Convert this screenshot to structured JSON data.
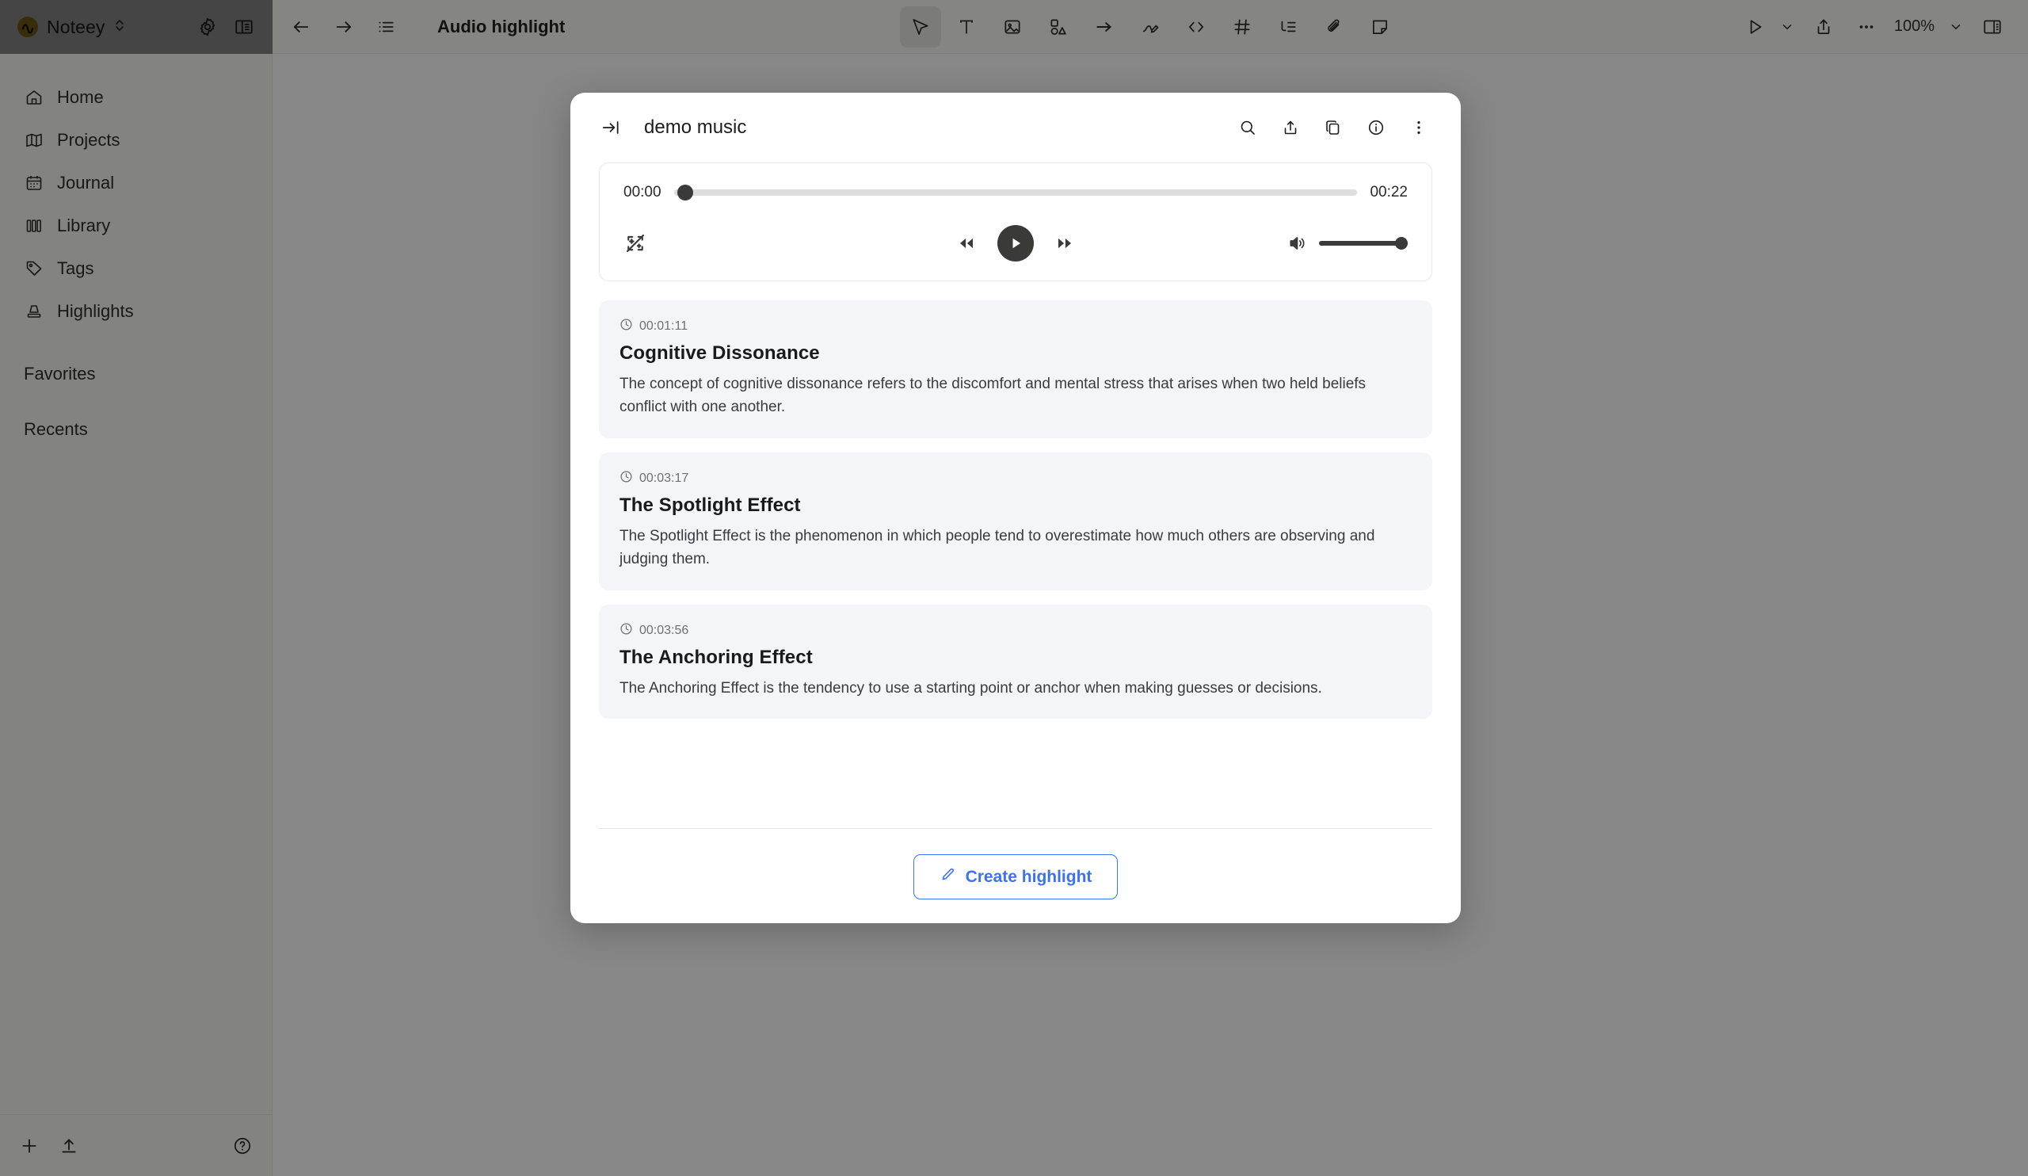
{
  "sidebar": {
    "app_name": "Noteey",
    "logo_color": "#c9a227",
    "top_icons": [
      {
        "name": "settings-gear-icon",
        "label": "Settings"
      },
      {
        "name": "toggle-sidebar-icon",
        "label": "Toggle sidebar"
      }
    ],
    "items": [
      {
        "label": "Home",
        "icon": "home-icon"
      },
      {
        "label": "Projects",
        "icon": "map-icon"
      },
      {
        "label": "Journal",
        "icon": "calendar-icon"
      },
      {
        "label": "Library",
        "icon": "books-icon"
      },
      {
        "label": "Tags",
        "icon": "tag-icon"
      },
      {
        "label": "Highlights",
        "icon": "highlighter-icon"
      }
    ],
    "sections": [
      {
        "label": "Favorites"
      },
      {
        "label": "Recents"
      }
    ],
    "bottom_icons": [
      {
        "name": "plus-icon",
        "label": "New"
      },
      {
        "name": "upload-icon",
        "label": "Import"
      },
      {
        "name": "help-icon",
        "label": "Help"
      }
    ]
  },
  "topbar": {
    "back_label": "Back",
    "forward_label": "Forward",
    "outline_label": "Outline",
    "title": "Audio highlight",
    "tools": [
      {
        "name": "cursor-tool",
        "label": "Select",
        "active": true
      },
      {
        "name": "text-tool",
        "label": "Text",
        "active": false
      },
      {
        "name": "image-tool",
        "label": "Image",
        "active": false
      },
      {
        "name": "shapes-tool",
        "label": "Shapes",
        "active": false
      },
      {
        "name": "arrow-tool",
        "label": "Arrow",
        "active": false
      },
      {
        "name": "pen-tool",
        "label": "Draw",
        "active": false
      },
      {
        "name": "code-tool",
        "label": "Code",
        "active": false
      },
      {
        "name": "table-tool",
        "label": "Table",
        "active": false
      },
      {
        "name": "list-tool",
        "label": "List",
        "active": false
      },
      {
        "name": "attachment-tool",
        "label": "Attachment",
        "active": false
      },
      {
        "name": "note-tool",
        "label": "Note",
        "active": false
      }
    ],
    "present_label": "Present",
    "share_label": "Share",
    "more_label": "More",
    "zoom_level": "100%",
    "panel_label": "Right panel"
  },
  "modal": {
    "collapse_label": "Collapse",
    "title": "demo music",
    "actions": [
      {
        "name": "search-icon",
        "label": "Search"
      },
      {
        "name": "share-upload-icon",
        "label": "Share"
      },
      {
        "name": "copy-icon",
        "label": "Copy"
      },
      {
        "name": "info-icon",
        "label": "Info"
      },
      {
        "name": "more-vertical-icon",
        "label": "More"
      }
    ],
    "player": {
      "current_time": "00:00",
      "total_time": "00:22",
      "progress_percent": 0,
      "volume_percent": 100,
      "transcribe_toggle_label": "Auto transcribe off",
      "rewind_label": "Rewind",
      "play_label": "Play",
      "forward_label": "Forward",
      "volume_label": "Volume"
    },
    "highlights": [
      {
        "timestamp": "00:01:11",
        "title": "Cognitive Dissonance",
        "body": "The concept of cognitive dissonance refers to the discomfort and mental stress that arises when two held beliefs conflict with one another."
      },
      {
        "timestamp": "00:03:17",
        "title": "The Spotlight Effect",
        "body": "The Spotlight Effect is the phenomenon in which people tend to overestimate how much others are observing and judging them."
      },
      {
        "timestamp": "00:03:56",
        "title": "The Anchoring Effect",
        "body": "The Anchoring Effect is the tendency to use a starting point or anchor when making guesses or decisions."
      }
    ],
    "create_button": {
      "label": "Create highlight",
      "icon": "pencil-icon",
      "accent_color": "#3b72f0"
    }
  }
}
